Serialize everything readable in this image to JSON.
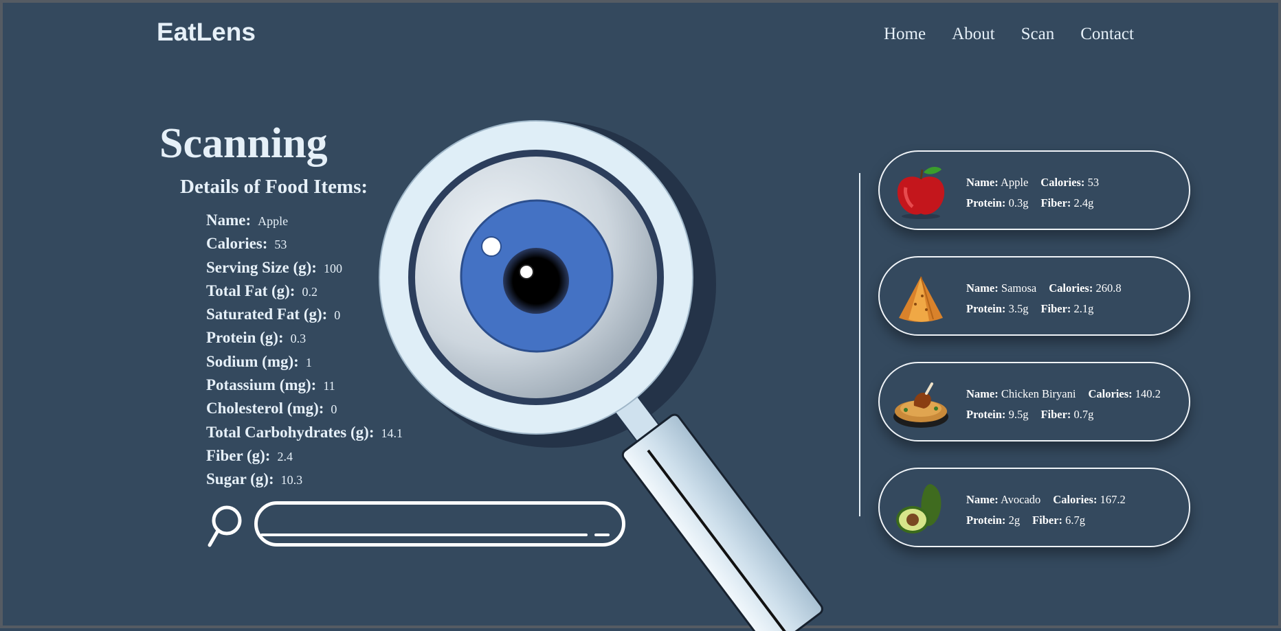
{
  "brand": "EatLens",
  "nav": [
    "Home",
    "About",
    "Scan",
    "Contact"
  ],
  "hero": {
    "title": "Scanning",
    "subtitle": "Details of Food Items:"
  },
  "details": [
    {
      "label": "Name:",
      "value": "Apple"
    },
    {
      "label": "Calories:",
      "value": "53"
    },
    {
      "label": "Serving Size (g):",
      "value": "100"
    },
    {
      "label": "Total Fat (g):",
      "value": "0.2"
    },
    {
      "label": "Saturated Fat (g):",
      "value": "0"
    },
    {
      "label": "Protein (g):",
      "value": "0.3"
    },
    {
      "label": "Sodium (mg):",
      "value": "1"
    },
    {
      "label": "Potassium (mg):",
      "value": "11"
    },
    {
      "label": "Cholesterol (mg):",
      "value": "0"
    },
    {
      "label": "Total Carbohydrates (g):",
      "value": "14.1"
    },
    {
      "label": "Fiber (g):",
      "value": "2.4"
    },
    {
      "label": "Sugar (g):",
      "value": "10.3"
    }
  ],
  "search": {
    "value": "",
    "placeholder": ""
  },
  "labels": {
    "name": "Name:",
    "calories": "Calories:",
    "protein": "Protein:",
    "fiber": "Fiber:"
  },
  "cards": [
    {
      "icon": "apple-icon",
      "name": "Apple",
      "calories": "53",
      "protein": "0.3g",
      "fiber": "2.4g"
    },
    {
      "icon": "samosa-icon",
      "name": "Samosa",
      "calories": "260.8",
      "protein": "3.5g",
      "fiber": "2.1g"
    },
    {
      "icon": "biryani-icon",
      "name": "Chicken Biryani",
      "calories": "140.2",
      "protein": "9.5g",
      "fiber": "0.7g"
    },
    {
      "icon": "avocado-icon",
      "name": "Avocado",
      "calories": "167.2",
      "protein": "2g",
      "fiber": "6.7g"
    }
  ],
  "colors": {
    "background": "#34495e",
    "text": "#e6f0f8",
    "iris": "#4472c4",
    "lens_ring": "#dfeef7"
  }
}
